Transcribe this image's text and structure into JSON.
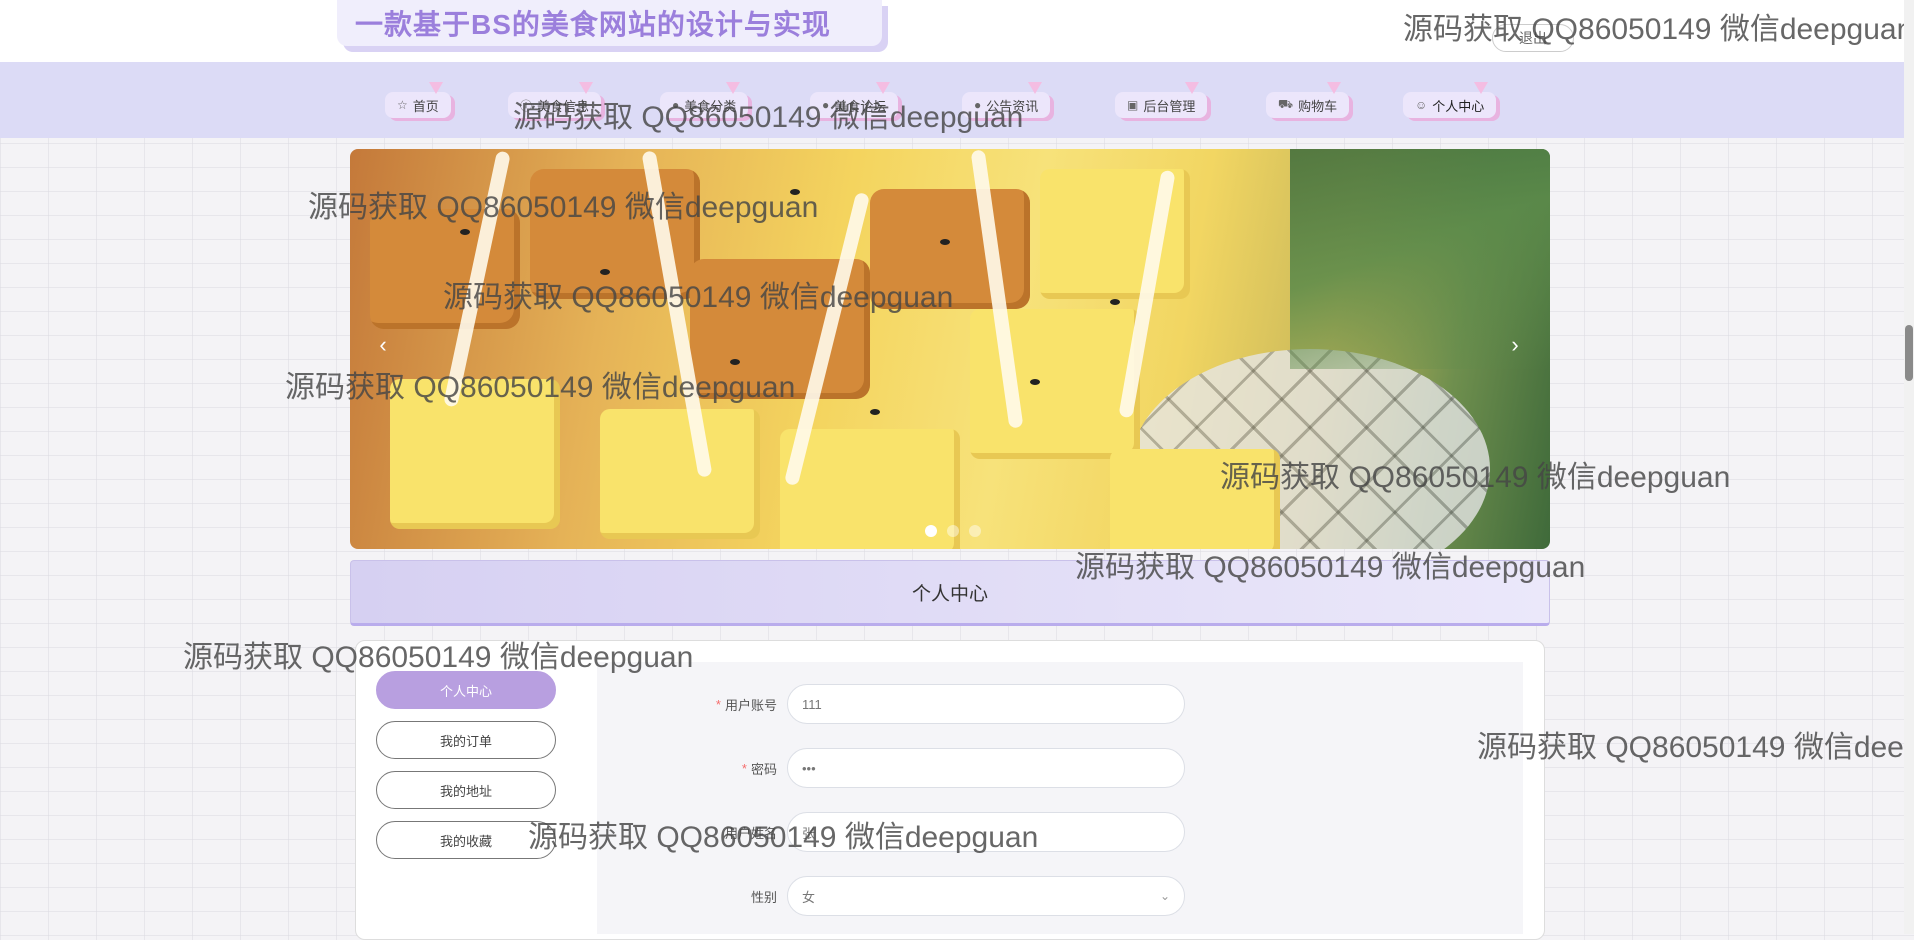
{
  "header": {
    "site_title": "一款基于BS的美食网站的设计与实现",
    "logout_label": "退出"
  },
  "nav": {
    "items": [
      {
        "label": "首页",
        "icon": "star-icon"
      },
      {
        "label": "美食信息",
        "icon": "info-icon"
      },
      {
        "label": "美食分类",
        "icon": "circle-icon"
      },
      {
        "label": "美食论坛",
        "icon": "circle-icon"
      },
      {
        "label": "公告资讯",
        "icon": "circle-icon"
      },
      {
        "label": "后台管理",
        "icon": "building-icon"
      },
      {
        "label": "购物车",
        "icon": "cart-icon"
      },
      {
        "label": "个人中心",
        "icon": "user-icon"
      }
    ]
  },
  "carousel": {
    "prev_icon": "‹",
    "next_icon": "›",
    "slide_count": 3,
    "active_slide": 1
  },
  "section": {
    "title": "个人中心"
  },
  "sidebar": {
    "items": [
      {
        "label": "个人中心",
        "active": true
      },
      {
        "label": "我的订单",
        "active": false
      },
      {
        "label": "我的地址",
        "active": false
      },
      {
        "label": "我的收藏",
        "active": false
      }
    ]
  },
  "form": {
    "fields": [
      {
        "label": "用户账号",
        "required": true,
        "value": "111"
      },
      {
        "label": "密码",
        "required": true,
        "value": "•••"
      },
      {
        "label": "用户姓名",
        "required": false,
        "value": "张"
      },
      {
        "label": "性别",
        "required": false,
        "value": "女",
        "type": "select"
      }
    ]
  },
  "watermark": {
    "text": "源码获取 QQ86050149 微信deepguan"
  },
  "colors": {
    "accent": "#b89fe0",
    "nav_bg": "#dcdbf6",
    "title_color": "#9b7fdc"
  }
}
